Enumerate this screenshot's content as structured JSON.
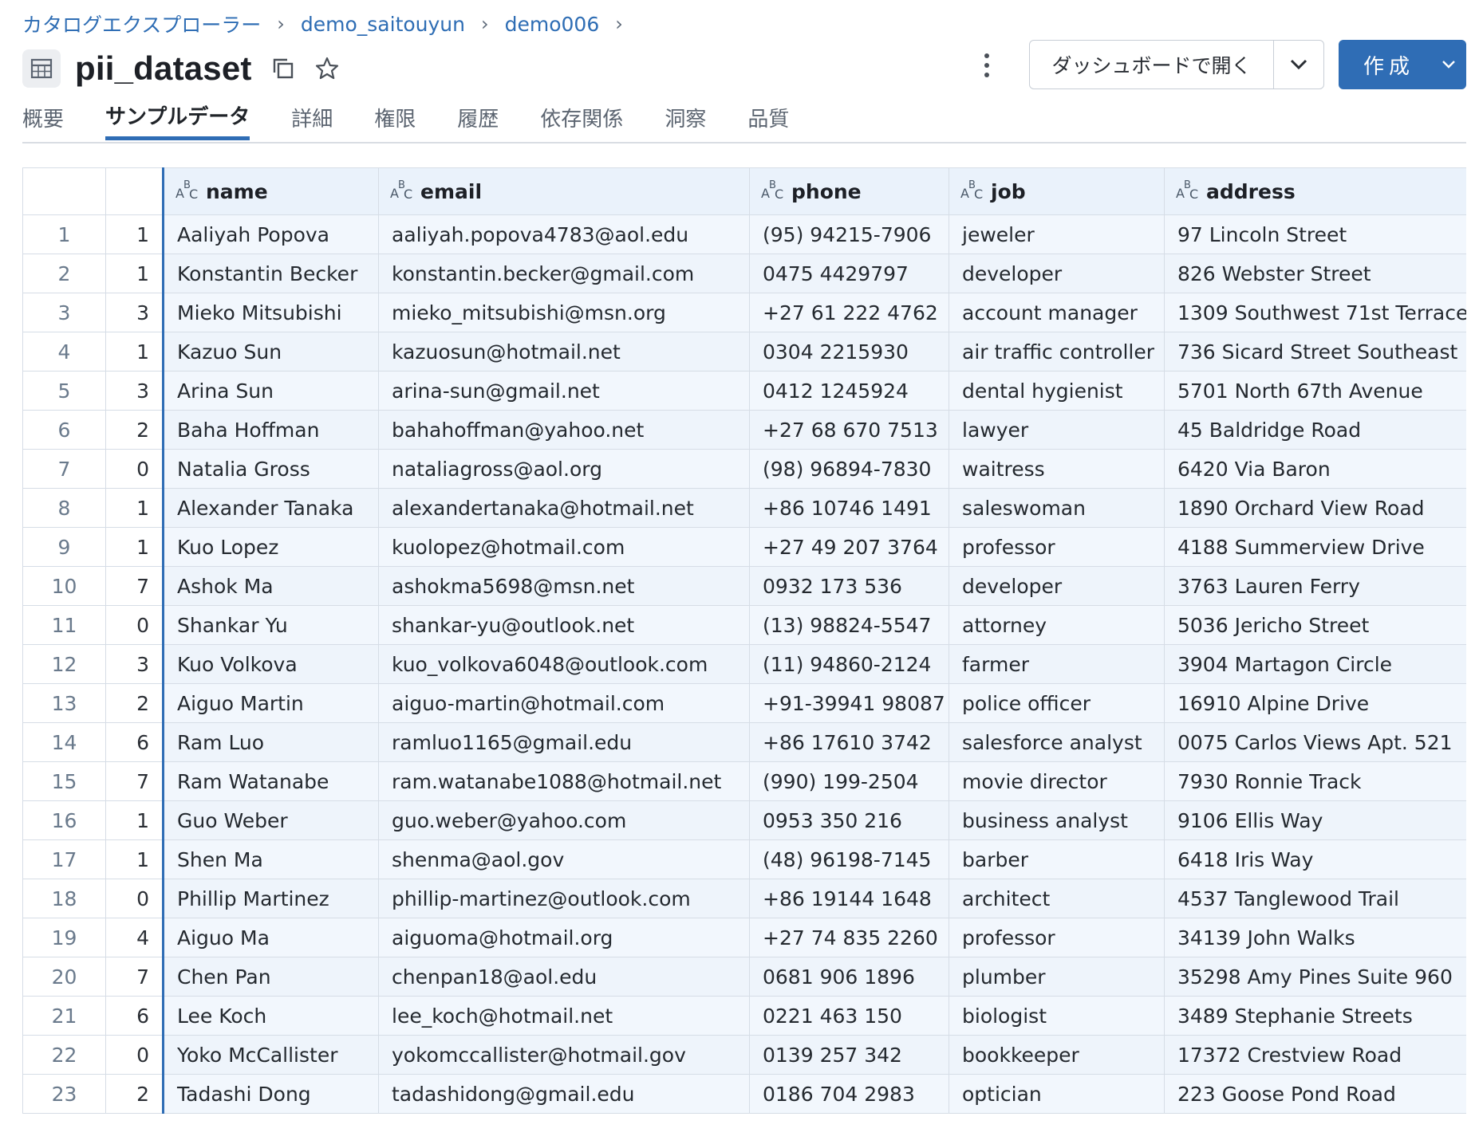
{
  "breadcrumb": [
    {
      "label": "カタログエクスプローラー"
    },
    {
      "label": "demo_saitouyun"
    },
    {
      "label": "demo006"
    }
  ],
  "breadcrumb_separator": "›",
  "title": "pii_dataset",
  "actions": {
    "open_dashboard_label": "ダッシュボードで開く",
    "create_label": "作成"
  },
  "tabs": [
    {
      "label": "概要"
    },
    {
      "label": "サンプルデータ",
      "active": true
    },
    {
      "label": "詳細"
    },
    {
      "label": "権限"
    },
    {
      "label": "履歴"
    },
    {
      "label": "依存関係"
    },
    {
      "label": "洞察"
    },
    {
      "label": "品質"
    }
  ],
  "table": {
    "columns": [
      "name",
      "email",
      "phone",
      "job",
      "address"
    ],
    "rows": [
      {
        "idx": "1",
        "num": "1",
        "cells": [
          "Aaliyah Popova",
          "aaliyah.popova4783@aol.edu",
          "(95) 94215-7906",
          "jeweler",
          "97 Lincoln Street"
        ]
      },
      {
        "idx": "2",
        "num": "1",
        "cells": [
          "Konstantin Becker",
          "konstantin.becker@gmail.com",
          "0475 4429797",
          "developer",
          "826 Webster Street"
        ]
      },
      {
        "idx": "3",
        "num": "3",
        "cells": [
          "Mieko Mitsubishi",
          "mieko_mitsubishi@msn.org",
          "+27 61 222 4762",
          "account manager",
          "1309 Southwest 71st Terrace"
        ]
      },
      {
        "idx": "4",
        "num": "1",
        "cells": [
          "Kazuo Sun",
          "kazuosun@hotmail.net",
          "0304 2215930",
          "air traffic controller",
          "736 Sicard Street Southeast"
        ]
      },
      {
        "idx": "5",
        "num": "3",
        "cells": [
          "Arina Sun",
          "arina-sun@gmail.net",
          "0412 1245924",
          "dental hygienist",
          "5701 North 67th Avenue"
        ]
      },
      {
        "idx": "6",
        "num": "2",
        "cells": [
          "Baha Hoffman",
          "bahahoffman@yahoo.net",
          "+27 68 670 7513",
          "lawyer",
          "45 Baldridge Road"
        ]
      },
      {
        "idx": "7",
        "num": "0",
        "cells": [
          "Natalia Gross",
          "nataliagross@aol.org",
          "(98) 96894-7830",
          "waitress",
          "6420 Via Baron"
        ]
      },
      {
        "idx": "8",
        "num": "1",
        "cells": [
          "Alexander Tanaka",
          "alexandertanaka@hotmail.net",
          "+86 10746 1491",
          "saleswoman",
          "1890 Orchard View Road"
        ]
      },
      {
        "idx": "9",
        "num": "1",
        "cells": [
          "Kuo Lopez",
          "kuolopez@hotmail.com",
          "+27 49 207 3764",
          "professor",
          "4188 Summerview Drive"
        ]
      },
      {
        "idx": "10",
        "num": "7",
        "cells": [
          "Ashok Ma",
          "ashokma5698@msn.net",
          "0932 173 536",
          "developer",
          "3763 Lauren Ferry"
        ]
      },
      {
        "idx": "11",
        "num": "0",
        "cells": [
          "Shankar Yu",
          "shankar-yu@outlook.net",
          "(13) 98824-5547",
          "attorney",
          "5036 Jericho Street"
        ]
      },
      {
        "idx": "12",
        "num": "3",
        "cells": [
          "Kuo Volkova",
          "kuo_volkova6048@outlook.com",
          "(11) 94860-2124",
          "farmer",
          "3904 Martagon Circle"
        ]
      },
      {
        "idx": "13",
        "num": "2",
        "cells": [
          "Aiguo Martin",
          "aiguo-martin@hotmail.com",
          "+91-39941 98087",
          "police officer",
          "16910 Alpine Drive"
        ]
      },
      {
        "idx": "14",
        "num": "6",
        "cells": [
          "Ram Luo",
          "ramluo1165@gmail.edu",
          "+86 17610 3742",
          "salesforce analyst",
          "0075 Carlos Views Apt. 521"
        ]
      },
      {
        "idx": "15",
        "num": "7",
        "cells": [
          "Ram Watanabe",
          "ram.watanabe1088@hotmail.net",
          "(990) 199-2504",
          "movie director",
          "7930 Ronnie Track"
        ]
      },
      {
        "idx": "16",
        "num": "1",
        "cells": [
          "Guo Weber",
          "guo.weber@yahoo.com",
          "0953 350 216",
          "business analyst",
          "9106 Ellis Way"
        ]
      },
      {
        "idx": "17",
        "num": "1",
        "cells": [
          "Shen Ma",
          "shenma@aol.gov",
          "(48) 96198-7145",
          "barber",
          "6418 Iris Way"
        ]
      },
      {
        "idx": "18",
        "num": "0",
        "cells": [
          "Phillip Martinez",
          "phillip-martinez@outlook.com",
          "+86 19144 1648",
          "architect",
          "4537 Tanglewood Trail"
        ]
      },
      {
        "idx": "19",
        "num": "4",
        "cells": [
          "Aiguo Ma",
          "aiguoma@hotmail.org",
          "+27 74 835 2260",
          "professor",
          "34139 John Walks"
        ]
      },
      {
        "idx": "20",
        "num": "7",
        "cells": [
          "Chen Pan",
          "chenpan18@aol.edu",
          "0681 906 1896",
          "plumber",
          "35298 Amy Pines Suite 960"
        ]
      },
      {
        "idx": "21",
        "num": "6",
        "cells": [
          "Lee Koch",
          "lee_koch@hotmail.net",
          "0221 463 150",
          "biologist",
          "3489 Stephanie Streets"
        ]
      },
      {
        "idx": "22",
        "num": "0",
        "cells": [
          "Yoko McCallister",
          "yokomccallister@hotmail.gov",
          "0139 257 342",
          "bookkeeper",
          "17372 Crestview Road"
        ]
      },
      {
        "idx": "23",
        "num": "2",
        "cells": [
          "Tadashi Dong",
          "tadashidong@gmail.edu",
          "0186 704 2983",
          "optician",
          "223 Goose Pond Road"
        ]
      }
    ]
  },
  "colors": {
    "accent": "#2f6db5",
    "link": "#2e6db4",
    "header_bg": "#eaf2fb",
    "cell_bg": "#f2f7fd"
  },
  "icons": [
    "table-icon",
    "copy-icon",
    "star-icon",
    "kebab-icon",
    "chevron-down-icon",
    "string-type-icon"
  ]
}
